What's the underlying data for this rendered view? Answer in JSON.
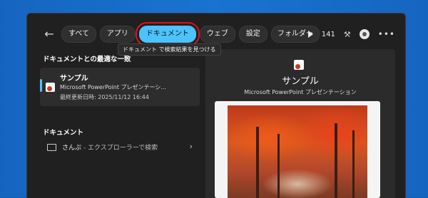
{
  "tabs": [
    {
      "label": "すべて"
    },
    {
      "label": "アプリ"
    },
    {
      "label": "ドキュメント"
    },
    {
      "label": "ウェブ"
    },
    {
      "label": "設定"
    },
    {
      "label": "フォルダー"
    }
  ],
  "active_tab_index": 2,
  "points": "141",
  "tooltip": "ドキュメント で検索結果を見つける",
  "best_match": {
    "section_title": "ドキュメントとの最適な一致",
    "name": "サンプル",
    "type": "Microsoft PowerPoint プレゼンテーシ...",
    "modified": "最終更新日時: 2025/11/12 16:44"
  },
  "documents": {
    "section_title": "ドキュメント",
    "explorer_query": "さんぷ",
    "explorer_suffix": " - エクスプローラーで検索"
  },
  "preview": {
    "title": "サンプル",
    "type": "Microsoft PowerPoint プレゼンテーション"
  },
  "colors": {
    "accent": "#4cc2ff",
    "highlight_box": "#e0101d",
    "desktop": "#1565c0"
  }
}
